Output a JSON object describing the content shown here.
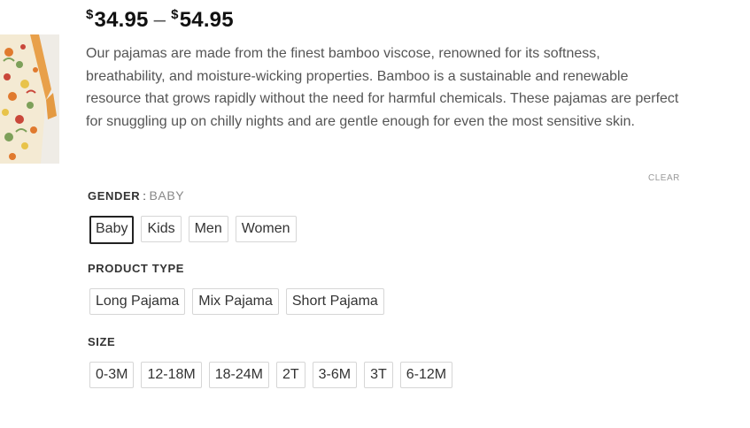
{
  "price": {
    "currency": "$",
    "min": "34.95",
    "separator": "–",
    "max": "54.95"
  },
  "description": "Our pajamas are made from the finest bamboo viscose, renowned for its softness, breathability, and moisture-wicking properties. Bamboo is a sustainable and renewable resource that grows rapidly without the need for harmful chemicals. These pajamas are perfect for snuggling up on chilly nights and are gentle enough for even the most sensitive skin.",
  "clear_label": "CLEAR",
  "gender": {
    "label": "GENDER",
    "separator": ":",
    "selected": "BABY",
    "options": [
      "Baby",
      "Kids",
      "Men",
      "Women"
    ],
    "active_index": 0
  },
  "product_type": {
    "label": "PRODUCT TYPE",
    "options": [
      "Long Pajama",
      "Mix Pajama",
      "Short Pajama"
    ]
  },
  "size": {
    "label": "SIZE",
    "options": [
      "0-3M",
      "12-18M",
      "18-24M",
      "2T",
      "3-6M",
      "3T",
      "6-12M"
    ]
  },
  "thumbnail": {
    "icon": "product-image",
    "colors": {
      "fabric": "#f4ead3",
      "trim": "#e8a04a",
      "floral_orange": "#e07a2e",
      "floral_green": "#7da05a",
      "floral_red": "#c9473a",
      "floral_yellow": "#e8c34a"
    }
  }
}
